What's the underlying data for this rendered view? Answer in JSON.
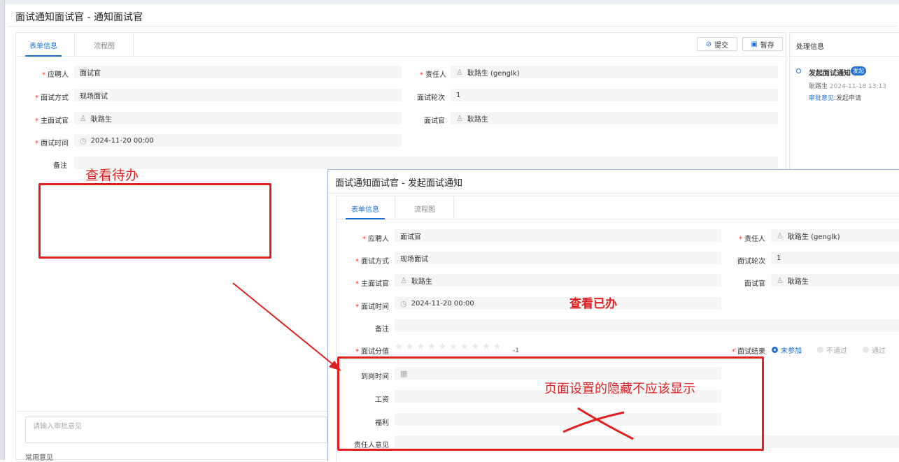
{
  "background_window": {
    "title": "面试通知面试官 - 通知面试官",
    "tabs": [
      "表单信息",
      "流程图"
    ],
    "buttons": {
      "submit": "提交",
      "save": "暂存"
    },
    "fields": {
      "applicant": {
        "label": "应聘人",
        "value": "面试官"
      },
      "owner": {
        "label": "责任人",
        "value": "耿路生 (genglk)"
      },
      "method": {
        "label": "面试方式",
        "value": "现场面试"
      },
      "round": {
        "label": "面试轮次",
        "value": "1"
      },
      "main_interviewer": {
        "label": "主面试官",
        "value": "耿路生"
      },
      "interviewer": {
        "label": "面试官",
        "value": "耿路生"
      },
      "time": {
        "label": "面试时间",
        "value": "2024-11-20 00:00"
      },
      "remark": {
        "label": "备注",
        "value": ""
      }
    },
    "approval_placeholder": "请输入审批意见",
    "common_opinion": "常用意见",
    "side": {
      "title": "处理信息",
      "step": "发起面试通知",
      "badge": "发起",
      "user": "耿路生",
      "time": "2024-11-18 13:13",
      "opinion_label": "审批意见:",
      "opinion": "发起申请"
    }
  },
  "foreground_window": {
    "title": "面试通知面试官 - 发起面试通知",
    "tabs": [
      "表单信息",
      "流程图"
    ],
    "fields": {
      "applicant": {
        "label": "应聘人",
        "value": "面试官"
      },
      "owner": {
        "label": "责任人",
        "value": "耿路生 (genglk)"
      },
      "method": {
        "label": "面试方式",
        "value": "现场面试"
      },
      "round": {
        "label": "面试轮次",
        "value": "1"
      },
      "main_interviewer": {
        "label": "主面试官",
        "value": "耿路生"
      },
      "interviewer": {
        "label": "面试官",
        "value": "耿路生"
      },
      "time": {
        "label": "面试时间",
        "value": "2024-11-20 00:00"
      },
      "remark": {
        "label": "备注",
        "value": ""
      },
      "score": {
        "label": "面试分值",
        "value": "-1"
      },
      "result": {
        "label": "面试结果",
        "options": [
          "未参加",
          "不通过",
          "通过"
        ],
        "selected": "未参加"
      },
      "arrival": {
        "label": "到岗时间",
        "value": ""
      },
      "salary": {
        "label": "工资",
        "value": ""
      },
      "welfare": {
        "label": "福利",
        "value": ""
      },
      "owner_opinion": {
        "label": "责任人意见",
        "value": ""
      }
    }
  },
  "annotations": {
    "pending": "查看待办",
    "done": "查看已办",
    "hidden_note": "页面设置的隐藏不应该显示",
    "color": "#e02020"
  },
  "accent_color": "#1f6fd6"
}
